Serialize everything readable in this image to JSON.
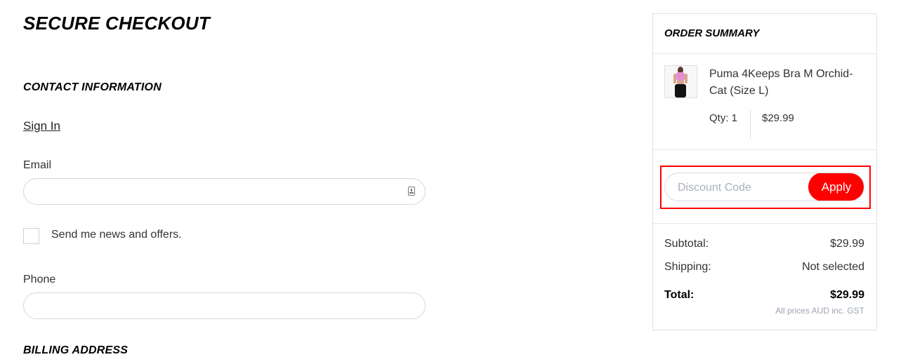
{
  "page_title": "SECURE CHECKOUT",
  "contact": {
    "heading": "CONTACT INFORMATION",
    "sign_in": "Sign In",
    "email_label": "Email",
    "email_value": "",
    "newsletter_label": "Send me news and offers.",
    "newsletter_checked": false,
    "phone_label": "Phone",
    "phone_value": ""
  },
  "billing": {
    "heading": "BILLING ADDRESS"
  },
  "summary": {
    "title": "ORDER SUMMARY",
    "item": {
      "name": "Puma 4Keeps Bra M Orchid-Cat (Size L)",
      "qty": "Qty: 1",
      "price": "$29.99"
    },
    "discount": {
      "placeholder": "Discount Code",
      "button": "Apply"
    },
    "subtotal_label": "Subtotal:",
    "subtotal_value": "$29.99",
    "shipping_label": "Shipping:",
    "shipping_value": "Not selected",
    "total_label": "Total:",
    "total_value": "$29.99",
    "tax_note": "All prices AUD inc. GST"
  },
  "colors": {
    "accent": "#ff0000",
    "highlight_border": "#ff0000"
  }
}
